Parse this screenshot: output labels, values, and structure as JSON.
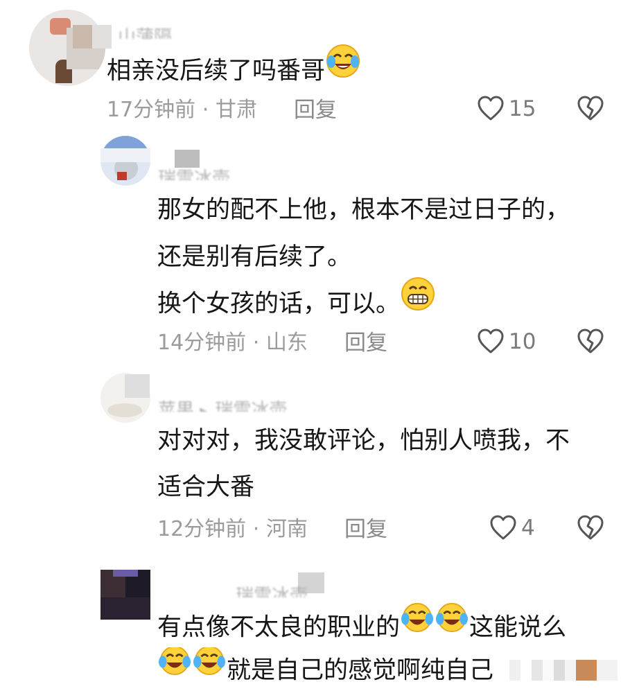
{
  "comments": [
    {
      "username": "山蒲隔",
      "lines": [
        "相亲没后续了吗番哥"
      ],
      "time": "17分钟前",
      "location": "甘肃",
      "reply_label": "回复",
      "likes": "15",
      "emoji_end": "crying-laughing"
    },
    {
      "username": "瑞雪冰壶",
      "lines": [
        "那女的配不上他，根本不是过日子的，",
        "还是别有后续了。",
        "换个女孩的话，可以。"
      ],
      "time": "14分钟前",
      "location": "山东",
      "reply_label": "回复",
      "likes": "10",
      "emoji_end": "grinning"
    },
    {
      "username": "苹果",
      "reply_to": "瑞雪冰壶",
      "lines": [
        "对对对，我没敢评论，怕别人喷我，不",
        "适合大番"
      ],
      "time": "12分钟前",
      "location": "河南",
      "reply_label": "回复",
      "likes": "4"
    },
    {
      "username": "瑞雪冰壶",
      "lines": [
        "有点像不太良的职业的",
        "这能说么",
        "就是自己的感觉啊纯自己"
      ],
      "emoji_inline": "crying-laughing"
    }
  ],
  "separator": "·",
  "colors": {
    "text": "#161616",
    "meta": "#9b9b9b",
    "icon": "#555555"
  }
}
